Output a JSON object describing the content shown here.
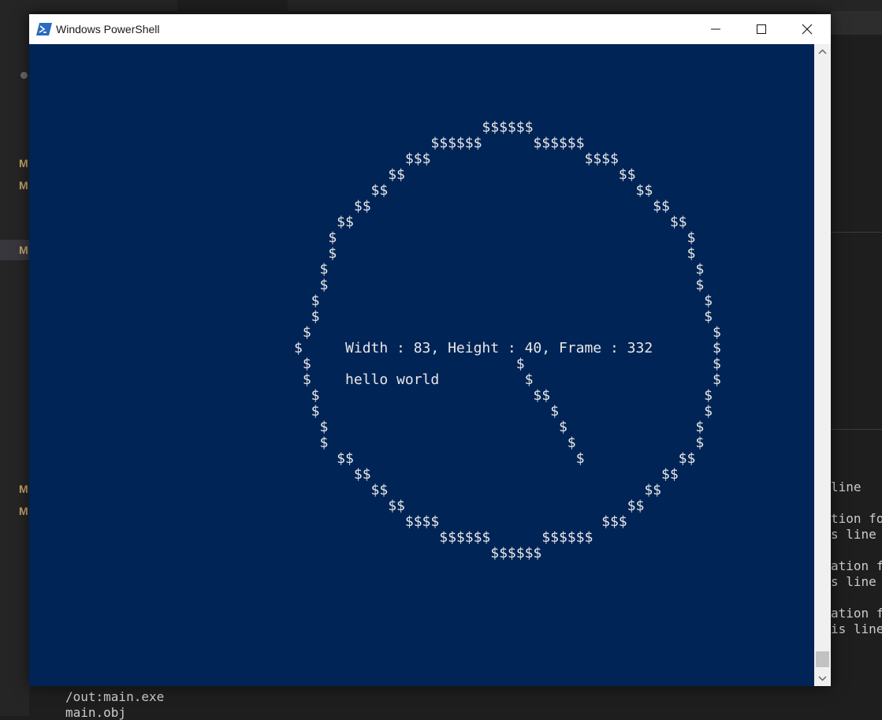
{
  "window": {
    "title": "Windows PowerShell",
    "minimize_icon": "minimize-icon",
    "maximize_icon": "maximize-icon",
    "close_icon": "close-icon"
  },
  "console": {
    "background": "#012456",
    "foreground": "#e8e8e8",
    "art": "                      $$$$$$\n                $$$$$$      $$$$$$\n             $$$                  $$$$\n           $$                         $$\n         $$                             $$\n       $$                                 $$\n     $$                                     $$\n    $                                         $\n    $                                         $\n   $                                           $\n   $                                           $\n  $                                             $\n  $                                             $\n $                                               $\n$     Width : 83, Height : 40, Frame : 332       $\n $                        $                      $\n $    hello world          $                     $\n  $                         $$                  $\n  $                           $                 $\n   $                           $               $\n   $                            $              $\n     $$                          $           $$\n       $$                                  $$\n         $$                              $$\n           $$                          $$\n             $$$$                   $$$\n                 $$$$$$      $$$$$$\n                       $$$$$$"
  },
  "background_editor": {
    "bottom_lines": [
      "/out:main.exe",
      "main.obj"
    ],
    "right_lines": [
      "line",
      "tion fo",
      "s line",
      "ation f",
      "s line",
      "ation f",
      "is line"
    ],
    "left_badges": [
      "M",
      "M",
      "M",
      "M",
      "M"
    ]
  }
}
